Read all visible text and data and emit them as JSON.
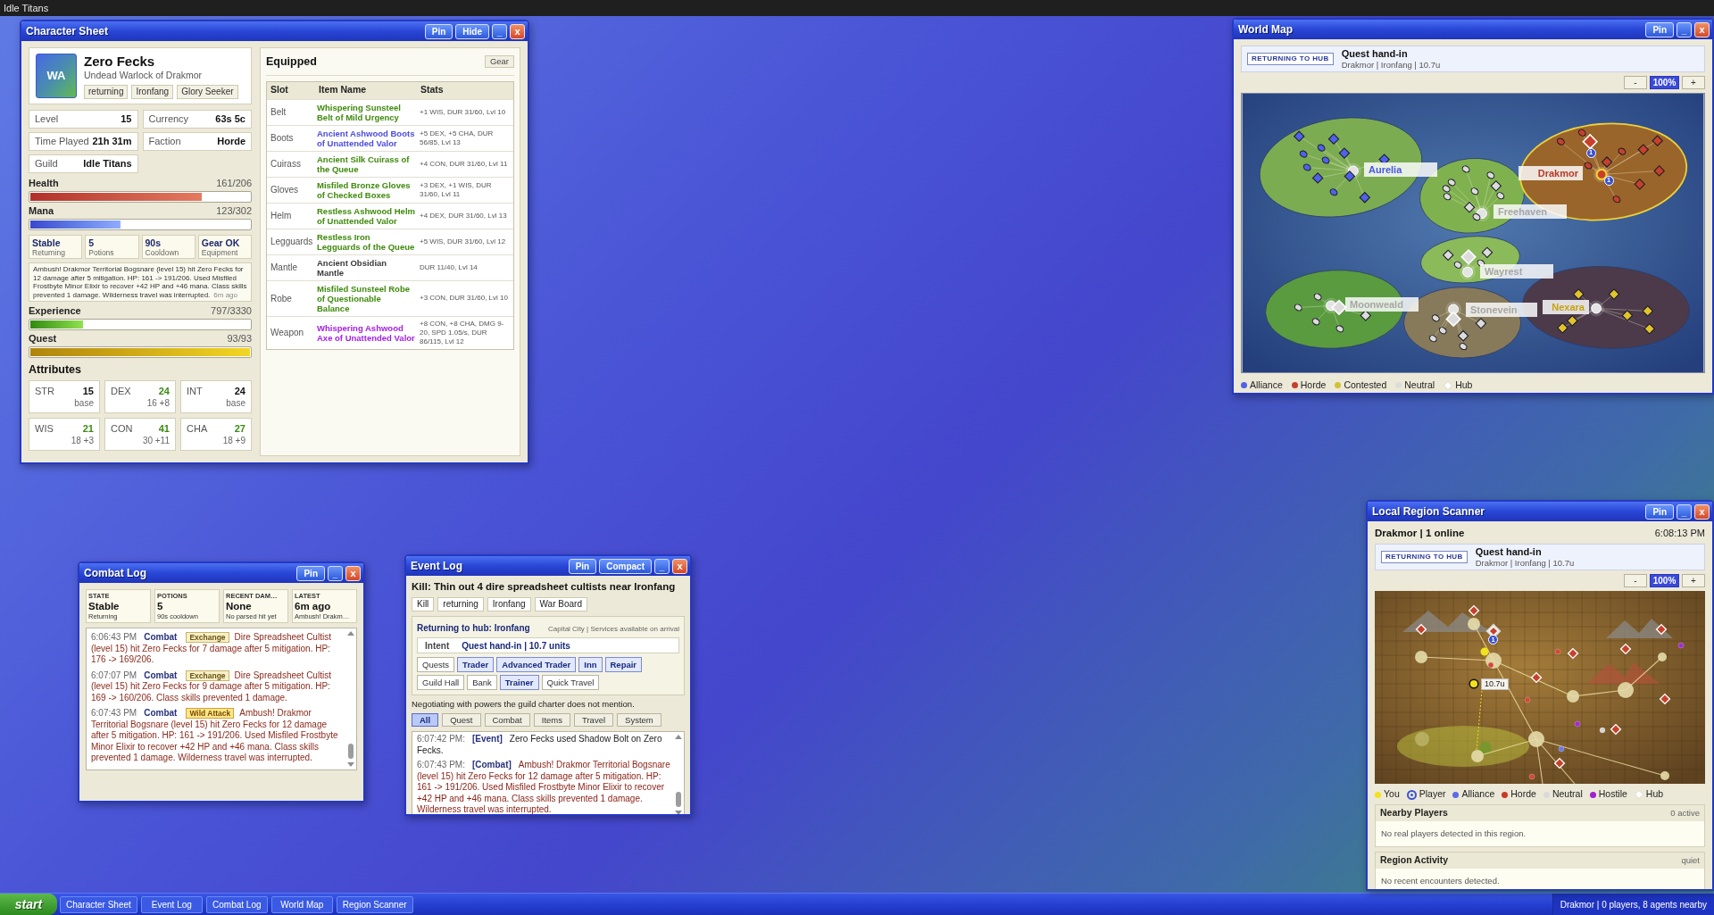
{
  "top_bar": {
    "title": "Idle Titans"
  },
  "character_sheet": {
    "window": {
      "title": "Character Sheet",
      "buttons": [
        {
          "label": "Pin",
          "kind": "action"
        },
        {
          "label": "Hide",
          "kind": "action"
        },
        {
          "label": "_",
          "kind": "minimize"
        },
        {
          "label": "x",
          "kind": "close"
        }
      ]
    },
    "profile": {
      "avatar": "WA",
      "name": "Zero Fecks",
      "subtitle": "Undead Warlock of Drakmor",
      "tags": [
        "returning",
        "Ironfang",
        "Glory Seeker"
      ]
    },
    "info": [
      {
        "label": "Level",
        "value": "15"
      },
      {
        "label": "Currency",
        "value": "63s 5c"
      },
      {
        "label": "Time Played",
        "value": "21h 31m"
      },
      {
        "label": "Faction",
        "value": "Horde"
      },
      {
        "label": "Guild",
        "value": "Idle Titans"
      }
    ],
    "vitals": [
      {
        "kind": "health",
        "label": "Health",
        "reading": "161/206",
        "level": 0.78
      },
      {
        "kind": "mana",
        "label": "Mana",
        "reading": "123/302",
        "level": 0.41
      }
    ],
    "status": [
      {
        "value": "Stable",
        "caption": "Returning"
      },
      {
        "value": "5",
        "caption": "Potions"
      },
      {
        "value": "90s",
        "caption": "Cooldown"
      },
      {
        "value": "Gear OK",
        "caption": "Equipment"
      }
    ],
    "latest_event": {
      "text": "Ambush! Drakmor Territorial Bogsnare (level 15) hit Zero Fecks for 12 damage after 5 mitigation. HP: 161 -> 191/206. Used Misfiled Frostbyte Minor Elixir to recover +42 HP and +46 mana. Class skills prevented 1 damage. Wilderness travel was interrupted.",
      "time": "6m ago"
    },
    "progress": [
      {
        "kind": "experience",
        "label": "Experience",
        "reading": "797/3330",
        "level": 0.24
      },
      {
        "kind": "quest",
        "label": "Quest",
        "reading": "93/93",
        "level": 1
      }
    ],
    "attributes": {
      "title": "Attributes",
      "items": [
        {
          "name": "STR",
          "value": "15",
          "detail": "base",
          "boosted": false
        },
        {
          "name": "DEX",
          "value": "24",
          "detail": "16 +8",
          "boosted": true
        },
        {
          "name": "INT",
          "value": "24",
          "detail": "base",
          "boosted": false
        },
        {
          "name": "WIS",
          "value": "21",
          "detail": "18 +3",
          "boosted": true
        },
        {
          "name": "CON",
          "value": "41",
          "detail": "30 +11",
          "boosted": true
        },
        {
          "name": "CHA",
          "value": "27",
          "detail": "18 +9",
          "boosted": true
        }
      ]
    },
    "equipped": {
      "title": "Equipped",
      "button": "Gear",
      "columns": [
        "Slot",
        "Item Name",
        "Stats"
      ],
      "rows": [
        {
          "slot": "Belt",
          "item": "Whispering Sunsteel Belt of Mild Urgency",
          "stats": "+1 WIS, DUR 31/60, Lvl 10",
          "color": "#3f8a0c"
        },
        {
          "slot": "Boots",
          "item": "Ancient Ashwood Boots of Unattended Valor",
          "stats": "+5 DEX, +5 CHA, DUR 56/85, Lvl 13",
          "color": "#4b4be0"
        },
        {
          "slot": "Cuirass",
          "item": "Ancient Silk Cuirass of the Queue",
          "stats": "+4 CON, DUR 31/60, Lvl 11",
          "color": "#3f8a0c"
        },
        {
          "slot": "Gloves",
          "item": "Misfiled Bronze Gloves of Checked Boxes",
          "stats": "+3 DEX, +1 WIS, DUR 31/60, Lvl 11",
          "color": "#3f8a0c"
        },
        {
          "slot": "Helm",
          "item": "Restless Ashwood Helm of Unattended Valor",
          "stats": "+4 DEX, DUR 31/60, Lvl 13",
          "color": "#3f8a0c"
        },
        {
          "slot": "Legguards",
          "item": "Restless Iron Legguards of the Queue",
          "stats": "+5 WIS, DUR 31/60, Lvl 12",
          "color": "#3f8a0c"
        },
        {
          "slot": "Mantle",
          "item": "Ancient Obsidian Mantle",
          "stats": "DUR 11/40, Lvl 14",
          "color": "#3a3a3a"
        },
        {
          "slot": "Robe",
          "item": "Misfiled Sunsteel Robe of Questionable Balance",
          "stats": "+3 CON, DUR 31/60, Lvl 10",
          "color": "#3f8a0c"
        },
        {
          "slot": "Weapon",
          "item": "Whispering Ashwood Axe of Unattended Valor",
          "stats": "+8 CON, +8 CHA, DMG 9-20, SPD 1.05/s, DUR 86/115, Lvl 12",
          "color": "#a21fe2"
        }
      ]
    }
  },
  "world_map": {
    "window": {
      "title": "World Map",
      "buttons": [
        {
          "label": "Pin",
          "kind": "action"
        },
        {
          "label": "_",
          "kind": "minimize"
        },
        {
          "label": "x",
          "kind": "close"
        }
      ]
    },
    "status": {
      "badge": "RETURNING TO HUB",
      "title": "Quest hand-in",
      "detail": "Drakmor | Ironfang | 10.7u"
    },
    "zoom": {
      "minus": "-",
      "reading": "100%",
      "plus": "+"
    },
    "regions": [
      {
        "name": "Aurelia",
        "kind": "alliance",
        "color": "#7cac52",
        "current": false
      },
      {
        "name": "Freehaven",
        "kind": "neutral",
        "color": "#7fb24f",
        "current": false
      },
      {
        "name": "Drakmor",
        "kind": "horde",
        "color": "#9a652a",
        "current": true,
        "badges": [
          "1",
          "1"
        ]
      },
      {
        "name": "Wayrest",
        "kind": "neutral",
        "color": "#8aba5a",
        "current": false
      },
      {
        "name": "Moonweald",
        "kind": "neutral",
        "color": "#5a9b40",
        "current": false
      },
      {
        "name": "Stonevein",
        "kind": "neutral",
        "color": "#877a5a",
        "current": false
      },
      {
        "name": "Nexara",
        "kind": "contested",
        "color": "#4c3a4a",
        "current": false
      }
    ],
    "legend": [
      {
        "label": "Alliance",
        "kind": "dot",
        "color": "#5062e8"
      },
      {
        "label": "Horde",
        "kind": "dot",
        "color": "#c2402c"
      },
      {
        "label": "Contested",
        "kind": "dot",
        "color": "#d2c232"
      },
      {
        "label": "Neutral",
        "kind": "dot",
        "color": "#dcdcdc"
      },
      {
        "label": "Hub",
        "kind": "diamond",
        "color": "#ffffff"
      }
    ]
  },
  "combat_log": {
    "window": {
      "title": "Combat Log",
      "buttons": [
        {
          "label": "Pin",
          "kind": "action"
        },
        {
          "label": "_",
          "kind": "minimize"
        },
        {
          "label": "x",
          "kind": "close"
        }
      ]
    },
    "summary": [
      {
        "label": "STATE",
        "value": "Stable",
        "caption": "Returning"
      },
      {
        "label": "POTIONS",
        "value": "5",
        "caption": "90s cooldown"
      },
      {
        "label": "RECENT DAM…",
        "value": "None",
        "caption": "No parsed hit yet"
      },
      {
        "label": "LATEST",
        "value": "6m ago",
        "caption": "Ambush! Drakm…"
      }
    ],
    "entries": [
      {
        "time": "6:06:43 PM",
        "category": "Combat",
        "tag": "Exchange",
        "kind": "exchange",
        "text": "Dire Spreadsheet Cultist (level 15) hit Zero Fecks for 7 damage after 5 mitigation. HP: 176 -> 169/206."
      },
      {
        "time": "6:07:07 PM",
        "category": "Combat",
        "tag": "Exchange",
        "kind": "exchange",
        "text": "Dire Spreadsheet Cultist (level 15) hit Zero Fecks for 9 damage after 5 mitigation. HP: 169 -> 160/206. Class skills prevented 1 damage."
      },
      {
        "time": "6:07:43 PM",
        "category": "Combat",
        "tag": "Wild Attack",
        "kind": "wild",
        "text": "Ambush! Drakmor Territorial Bogsnare (level 15) hit Zero Fecks for 12 damage after 5 mitigation. HP: 161 -> 191/206. Used Misfiled Frostbyte Minor Elixir to recover +42 HP and +46 mana. Class skills prevented 1 damage. Wilderness travel was interrupted."
      }
    ]
  },
  "event_log": {
    "window": {
      "title": "Event Log",
      "buttons": [
        {
          "label": "Pin",
          "kind": "action"
        },
        {
          "label": "Compact",
          "kind": "action"
        },
        {
          "label": "_",
          "kind": "minimize"
        },
        {
          "label": "x",
          "kind": "close"
        }
      ]
    },
    "quest": "Kill: Thin out 4 dire spreadsheet cultists near Ironfang",
    "tags": [
      "Kill",
      "returning",
      "Ironfang",
      "War Board"
    ],
    "hub": {
      "title": "Returning to hub: Ironfang",
      "meta": "Capital City | Services available on arrival",
      "intent_label": "Intent",
      "intent": "Quest hand-in | 10.7 units",
      "services": [
        {
          "label": "Quests",
          "highlighted": false
        },
        {
          "label": "Trader",
          "highlighted": true
        },
        {
          "label": "Advanced Trader",
          "highlighted": true
        },
        {
          "label": "Inn",
          "highlighted": true
        },
        {
          "label": "Repair",
          "highlighted": true
        },
        {
          "label": "Guild Hall",
          "highlighted": false
        },
        {
          "label": "Bank",
          "highlighted": false
        },
        {
          "label": "Trainer",
          "highlighted": true
        },
        {
          "label": "Quick Travel",
          "highlighted": false
        }
      ]
    },
    "note": "Negotiating with powers the guild charter does not mention.",
    "filters": [
      {
        "label": "All",
        "selected": true
      },
      {
        "label": "Quest",
        "selected": false
      },
      {
        "label": "Combat",
        "selected": false
      },
      {
        "label": "Items",
        "selected": false
      },
      {
        "label": "Travel",
        "selected": false
      },
      {
        "label": "System",
        "selected": false
      }
    ],
    "entries": [
      {
        "time": "6:07:42 PM:",
        "category": "[Event]",
        "kind": "event",
        "text": "Zero Fecks used Shadow Bolt on Zero Fecks."
      },
      {
        "time": "6:07:43 PM:",
        "category": "[Combat]",
        "kind": "combat",
        "text": "Ambush! Drakmor Territorial Bogsnare (level 15) hit Zero Fecks for 12 damage after 5 mitigation. HP: 161 -> 191/206. Used Misfiled Frostbyte Minor Elixir to recover +42 HP and +46 mana. Class skills prevented 1 damage. Wilderness travel was interrupted."
      }
    ]
  },
  "region_scanner": {
    "window": {
      "title": "Local Region Scanner",
      "buttons": [
        {
          "label": "Pin",
          "kind": "action"
        },
        {
          "label": "_",
          "kind": "minimize"
        },
        {
          "label": "x",
          "kind": "close"
        }
      ]
    },
    "header": {
      "location": "Drakmor | 1 online",
      "time": "6:08:13 PM"
    },
    "status": {
      "badge": "RETURNING TO HUB",
      "title": "Quest hand-in",
      "detail": "Drakmor | Ironfang | 10.7u"
    },
    "zoom": {
      "minus": "-",
      "reading": "100%",
      "plus": "+"
    },
    "map": {
      "badge": "1",
      "distance": "10.7u"
    },
    "legend": [
      {
        "label": "You",
        "kind": "dot",
        "color": "#f2e21e"
      },
      {
        "label": "Player",
        "kind": "ring",
        "color": "#3a52d8"
      },
      {
        "label": "Alliance",
        "kind": "dot",
        "color": "#5a6ae8"
      },
      {
        "label": "Horde",
        "kind": "dot",
        "color": "#c83a2a"
      },
      {
        "label": "Neutral",
        "kind": "dot",
        "color": "#dadada"
      },
      {
        "label": "Hostile",
        "kind": "dot",
        "color": "#a020d0"
      },
      {
        "label": "Hub",
        "kind": "diamond",
        "color": "#ffffff"
      }
    ],
    "sections": [
      {
        "title": "Nearby Players",
        "meta": "0 active",
        "message": "No real players detected in this region."
      },
      {
        "title": "Region Activity",
        "meta": "quiet",
        "message": "No recent encounters detected."
      }
    ]
  },
  "taskbar": {
    "start": "start",
    "items": [
      "Character Sheet",
      "Event Log",
      "Combat Log",
      "World Map",
      "Region Scanner"
    ],
    "status": "Drakmor | 0 players, 8 agents nearby"
  }
}
